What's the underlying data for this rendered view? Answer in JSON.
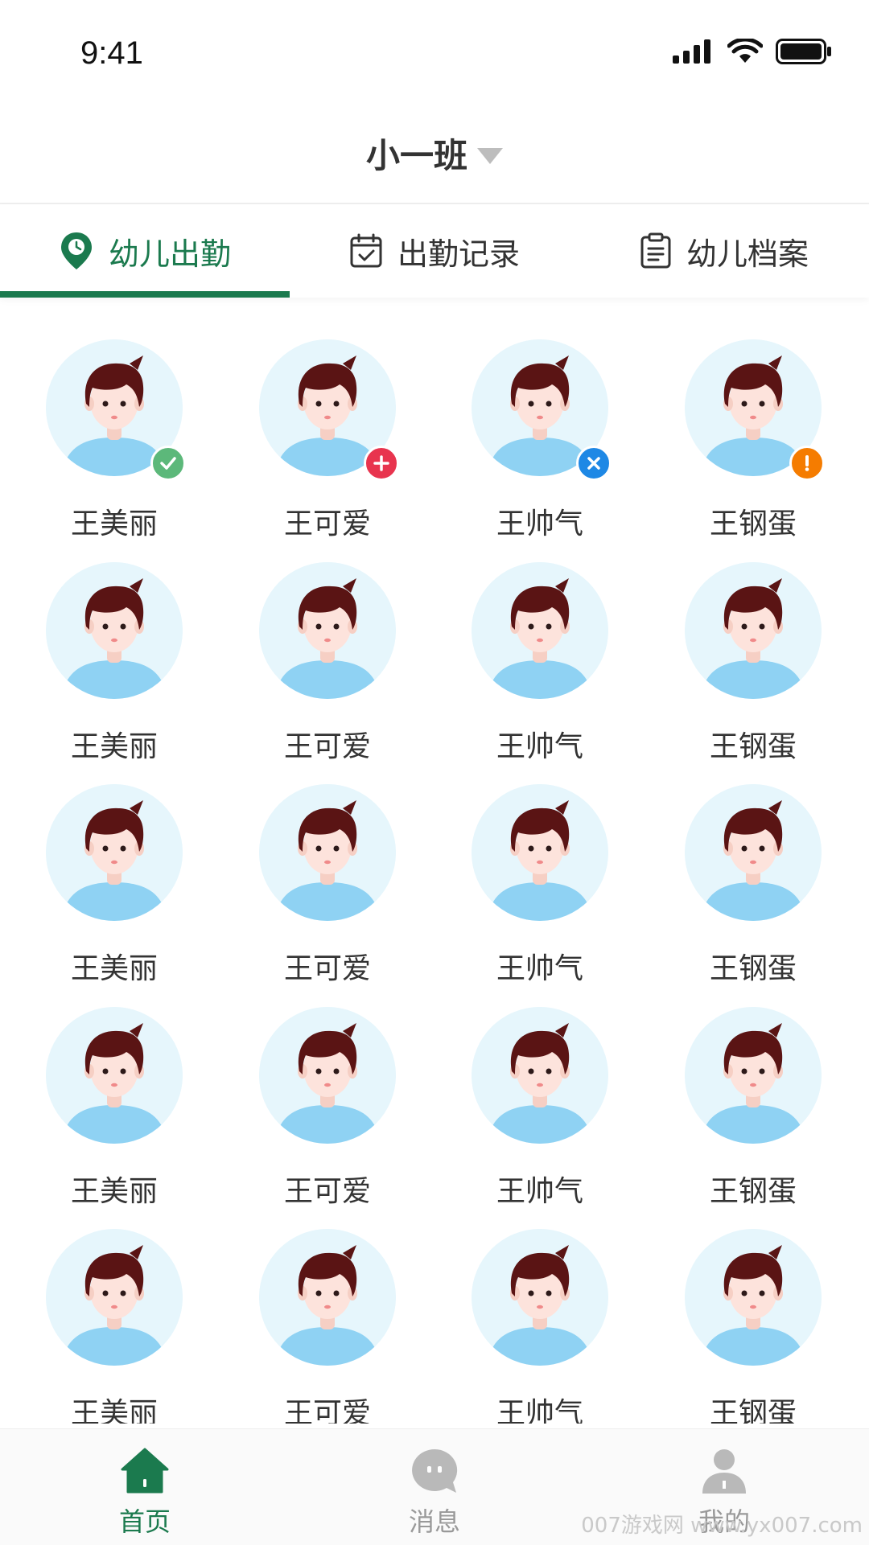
{
  "status_bar": {
    "time": "9:41"
  },
  "header": {
    "class_name": "小一班"
  },
  "tabs": [
    {
      "label": "幼儿出勤",
      "icon": "location-pin-icon",
      "active": true
    },
    {
      "label": "出勤记录",
      "icon": "calendar-check-icon",
      "active": false
    },
    {
      "label": "幼儿档案",
      "icon": "clipboard-icon",
      "active": false
    }
  ],
  "children": [
    {
      "name": "王美丽",
      "status": "checked-in-icon"
    },
    {
      "name": "王可爱",
      "status": "add-icon"
    },
    {
      "name": "王帅气",
      "status": "absent-icon"
    },
    {
      "name": "王钢蛋",
      "status": "alert-icon"
    },
    {
      "name": "王美丽"
    },
    {
      "name": "王可爱"
    },
    {
      "name": "王帅气"
    },
    {
      "name": "王钢蛋"
    },
    {
      "name": "王美丽"
    },
    {
      "name": "王可爱"
    },
    {
      "name": "王帅气"
    },
    {
      "name": "王钢蛋"
    },
    {
      "name": "王美丽"
    },
    {
      "name": "王可爱"
    },
    {
      "name": "王帅气"
    },
    {
      "name": "王钢蛋"
    },
    {
      "name": "王美丽"
    },
    {
      "name": "王可爱"
    },
    {
      "name": "王帅气"
    },
    {
      "name": "王钢蛋"
    }
  ],
  "bottom_nav": [
    {
      "label": "首页",
      "icon": "home-icon",
      "active": true
    },
    {
      "label": "消息",
      "icon": "message-icon",
      "active": false
    },
    {
      "label": "我的",
      "icon": "user-icon",
      "active": false
    }
  ],
  "watermark": "007游戏网 www.yx007.com",
  "colors": {
    "accent": "#1b7a4e",
    "checked_in": "#5cb87a",
    "add": "#e8344e",
    "absent": "#1e88e5",
    "alert": "#f57c00"
  }
}
